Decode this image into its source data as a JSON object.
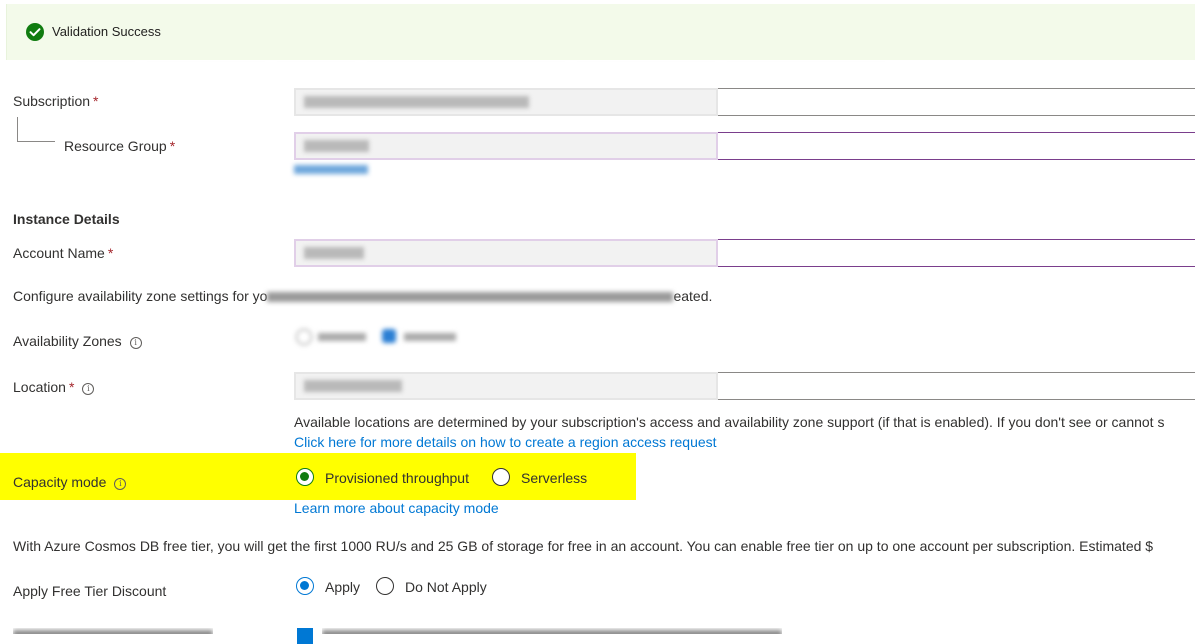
{
  "banner": {
    "message": "Validation Success",
    "color": "#107c10"
  },
  "fields": {
    "subscription": {
      "label": "Subscription",
      "required": "*"
    },
    "resource_group": {
      "label": "Resource Group",
      "required": "*"
    },
    "account_name": {
      "label": "Account Name",
      "required": "*"
    },
    "availability_zones": {
      "label": "Availability Zones",
      "info": "i"
    },
    "location": {
      "label": "Location",
      "required": "*",
      "info": "i"
    },
    "capacity_mode": {
      "label": "Capacity mode",
      "info": "i",
      "options": [
        "Provisioned throughput",
        "Serverless"
      ],
      "selected": "Provisioned throughput",
      "learn_more": "Learn more about capacity mode"
    },
    "free_tier": {
      "label": "Apply Free Tier Discount",
      "options": [
        "Apply",
        "Do Not Apply"
      ],
      "selected": "Apply"
    }
  },
  "sections": {
    "instance_details": "Instance Details"
  },
  "texts": {
    "availability_zone_prefix": "Configure availability zone settings for yo",
    "availability_zone_suffix": "eated.",
    "location_help": "Available locations are determined by your subscription's access and availability zone support (if that is enabled). If you don't see or cannot s",
    "region_request_link": "Click here for more details on how to create a region access request",
    "free_tier_info": "With Azure Cosmos DB free tier, you will get the first 1000 RU/s and 25 GB of storage for free in an account. You can enable free tier on up to one account per subscription. Estimated $"
  },
  "colors": {
    "accent": "#0078d4",
    "highlight": "#ffff00",
    "required": "#a4262c"
  }
}
